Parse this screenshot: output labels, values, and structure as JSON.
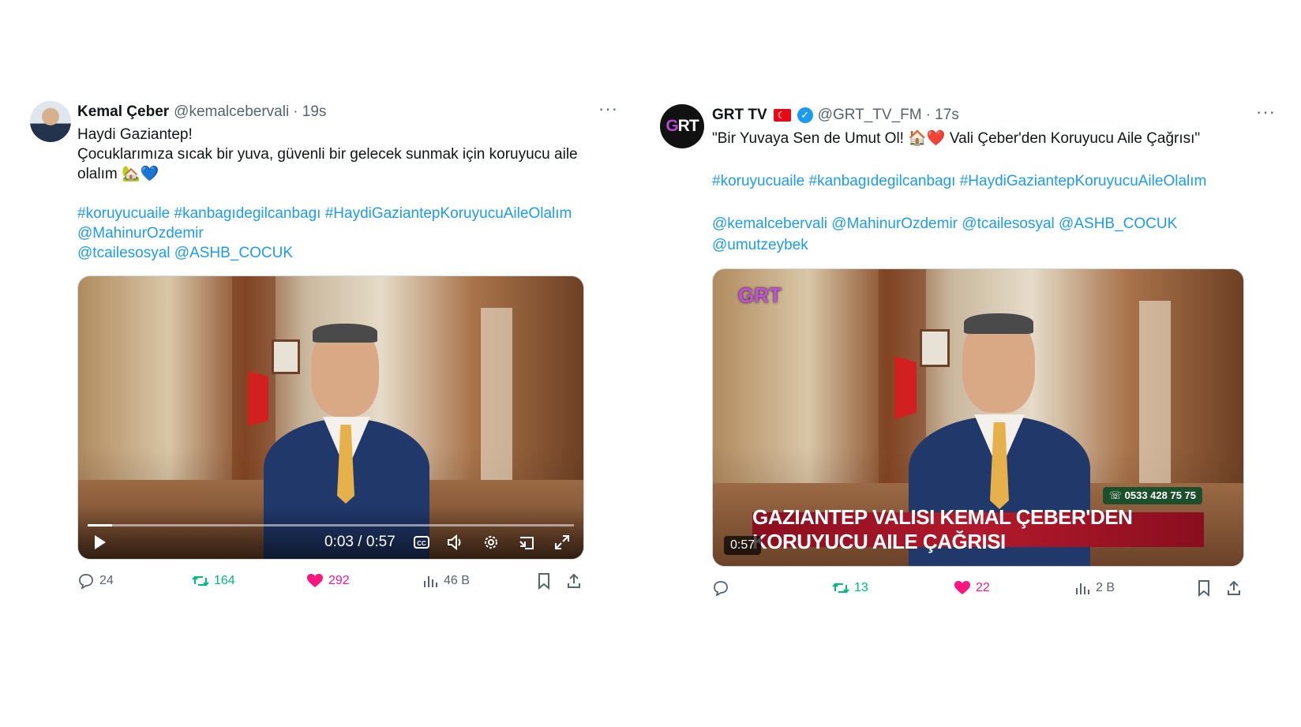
{
  "tweets": [
    {
      "name": "Kemal Çeber",
      "handle": "@kemalcebervali",
      "time": "· 19s",
      "more": "···",
      "lines": [
        "Haydi Gaziantep!",
        "Çocuklarımıza sıcak bir yuva, güvenli bir gelecek sunmak için koruyucu aile olalım 🏡💙"
      ],
      "hashtags": "#koruyucuaile #kanbagıdegilcanbagı #HaydiGaziantepKoruyucuAileOlalım",
      "mentions_1": "@MahinurOzdemir",
      "mentions_2": "@tcailesosyal @ASHB_COCUK",
      "video": {
        "time": "0:03 / 0:57",
        "progress": 0.05
      },
      "stats": {
        "replies": "24",
        "retweets": "164",
        "likes": "292",
        "views": "46 B"
      }
    },
    {
      "name": "GRT TV",
      "handle": "@GRT_TV_FM",
      "time": "· 17s",
      "more": "···",
      "logo_main": "G",
      "logo_accent": "RT",
      "headline": "\"Bir Yuvaya Sen de Umut Ol! 🏠❤️ Vali Çeber'den Koruyucu Aile Çağrısı\"",
      "hashtags": "#koruyucuaile #kanbagıdegilcanbagı #HaydiGaziantepKoruyucuAileOlalım",
      "mentions_1": "@kemalcebervali  @MahinurOzdemir @tcailesosyal @ASHB_COCUK",
      "mentions_2": "@umutzeybek",
      "video": {
        "logo": "GRT",
        "banner": "GAZIANTEP VALISI KEMAL ÇEBER'DEN KORUYUCU AILE ÇAĞRISI",
        "phone": "☏ 0533 428 75 75",
        "duration": "0:57"
      },
      "stats": {
        "retweets": "13",
        "likes": "22",
        "views": "2 B"
      }
    }
  ],
  "colors": {
    "accent": "#1d9bf0",
    "retweet": "#00ba7c",
    "like": "#f91880",
    "muted": "#536471"
  },
  "icons": [
    "reply-icon",
    "retweet-icon",
    "heart-icon",
    "views-icon",
    "bookmark-icon",
    "share-icon",
    "play-icon",
    "captions-icon",
    "volume-icon",
    "settings-icon",
    "pip-icon",
    "fullscreen-icon",
    "verified-icon",
    "flag-icon"
  ]
}
